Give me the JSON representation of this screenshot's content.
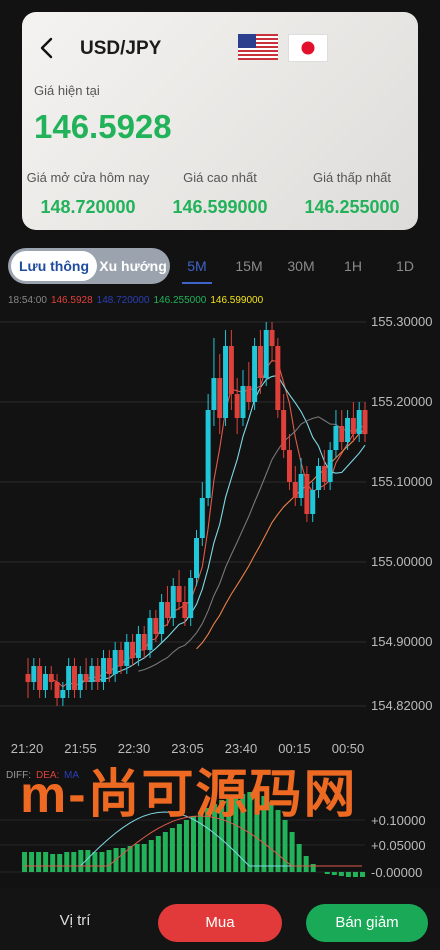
{
  "header": {
    "pair": "USD/JPY",
    "current_label": "Giá hiện tại",
    "current_price": "146.5928",
    "stats": [
      {
        "label": "Giá mở cửa hôm nay",
        "value": "148.720000"
      },
      {
        "label": "Giá cao nhất",
        "value": "146.599000"
      },
      {
        "label": "Giá thấp nhất",
        "value": "146.255000"
      }
    ]
  },
  "toggle": {
    "active": "Lưu thông",
    "inactive": "Xu hướng"
  },
  "timeframes": [
    "5M",
    "15M",
    "30M",
    "1H",
    "1D"
  ],
  "active_timeframe": "5M",
  "ma_line": {
    "time": "18:54:00",
    "v1": "146.5928",
    "v2": "148.720000",
    "v3": "146.255000",
    "v4": "146.599000"
  },
  "colors": {
    "up": "#1fc7d8",
    "down": "#e0403a",
    "green": "#21b25a",
    "accent": "#3f64c9"
  },
  "chart_data": {
    "type": "candlestick",
    "x_ticks": [
      "21:20",
      "21:55",
      "22:30",
      "23:05",
      "23:40",
      "00:15",
      "00:50"
    ],
    "y_ticks": [
      "155.30000",
      "155.20000",
      "155.10000",
      "155.00000",
      "154.90000",
      "154.82000"
    ],
    "ylim": [
      154.82,
      155.3
    ],
    "candles": [
      [
        154.86,
        154.85,
        154.88,
        154.83
      ],
      [
        154.85,
        154.87,
        154.88,
        154.84
      ],
      [
        154.87,
        154.84,
        154.88,
        154.83
      ],
      [
        154.84,
        154.86,
        154.87,
        154.83
      ],
      [
        154.86,
        154.85,
        154.87,
        154.84
      ],
      [
        154.85,
        154.83,
        154.86,
        154.82
      ],
      [
        154.83,
        154.84,
        154.85,
        154.82
      ],
      [
        154.84,
        154.87,
        154.88,
        154.83
      ],
      [
        154.87,
        154.84,
        154.88,
        154.83
      ],
      [
        154.84,
        154.86,
        154.87,
        154.83
      ],
      [
        154.86,
        154.85,
        154.88,
        154.84
      ],
      [
        154.85,
        154.87,
        154.88,
        154.84
      ],
      [
        154.87,
        154.85,
        154.88,
        154.84
      ],
      [
        154.85,
        154.88,
        154.89,
        154.84
      ],
      [
        154.88,
        154.86,
        154.89,
        154.85
      ],
      [
        154.86,
        154.89,
        154.9,
        154.85
      ],
      [
        154.89,
        154.87,
        154.9,
        154.86
      ],
      [
        154.87,
        154.9,
        154.91,
        154.86
      ],
      [
        154.9,
        154.88,
        154.91,
        154.87
      ],
      [
        154.88,
        154.91,
        154.92,
        154.87
      ],
      [
        154.91,
        154.89,
        154.92,
        154.88
      ],
      [
        154.89,
        154.93,
        154.94,
        154.88
      ],
      [
        154.93,
        154.91,
        154.94,
        154.9
      ],
      [
        154.91,
        154.95,
        154.96,
        154.9
      ],
      [
        154.95,
        154.93,
        154.97,
        154.92
      ],
      [
        154.93,
        154.97,
        154.98,
        154.92
      ],
      [
        154.97,
        154.95,
        154.99,
        154.94
      ],
      [
        154.95,
        154.93,
        154.97,
        154.92
      ],
      [
        154.93,
        154.98,
        154.99,
        154.92
      ],
      [
        154.98,
        155.03,
        155.04,
        154.97
      ],
      [
        155.03,
        155.08,
        155.1,
        155.02
      ],
      [
        155.08,
        155.19,
        155.21,
        155.07
      ],
      [
        155.19,
        155.23,
        155.28,
        155.17
      ],
      [
        155.23,
        155.18,
        155.26,
        155.16
      ],
      [
        155.18,
        155.27,
        155.29,
        155.17
      ],
      [
        155.27,
        155.21,
        155.29,
        155.19
      ],
      [
        155.21,
        155.18,
        155.23,
        155.16
      ],
      [
        155.18,
        155.22,
        155.24,
        155.17
      ],
      [
        155.22,
        155.2,
        155.25,
        155.19
      ],
      [
        155.2,
        155.27,
        155.28,
        155.19
      ],
      [
        155.27,
        155.23,
        155.29,
        155.21
      ],
      [
        155.23,
        155.29,
        155.3,
        155.22
      ],
      [
        155.29,
        155.27,
        155.3,
        155.25
      ],
      [
        155.27,
        155.19,
        155.28,
        155.18
      ],
      [
        155.19,
        155.14,
        155.21,
        155.13
      ],
      [
        155.14,
        155.1,
        155.16,
        155.09
      ],
      [
        155.1,
        155.08,
        155.12,
        155.07
      ],
      [
        155.08,
        155.11,
        155.13,
        155.07
      ],
      [
        155.11,
        155.06,
        155.12,
        155.05
      ],
      [
        155.06,
        155.09,
        155.1,
        155.05
      ],
      [
        155.09,
        155.12,
        155.13,
        155.08
      ],
      [
        155.12,
        155.1,
        155.14,
        155.09
      ],
      [
        155.1,
        155.14,
        155.15,
        155.09
      ],
      [
        155.14,
        155.17,
        155.19,
        155.13
      ],
      [
        155.17,
        155.15,
        155.19,
        155.14
      ],
      [
        155.15,
        155.18,
        155.19,
        155.14
      ],
      [
        155.18,
        155.16,
        155.2,
        155.15
      ],
      [
        155.16,
        155.19,
        155.2,
        155.15
      ],
      [
        155.19,
        155.16,
        155.2,
        155.15
      ]
    ]
  },
  "macd": {
    "labels": {
      "diff": "DIFF:",
      "dea": "DEA:",
      "macd": "MA"
    },
    "y_ticks": [
      "+0.10000",
      "+0.05000",
      "-0.00000"
    ]
  },
  "watermark": "m-尚可源码网",
  "bottom": {
    "position_label": "Vị trí",
    "buy_label": "Mua",
    "sell_label": "Bán giảm"
  }
}
